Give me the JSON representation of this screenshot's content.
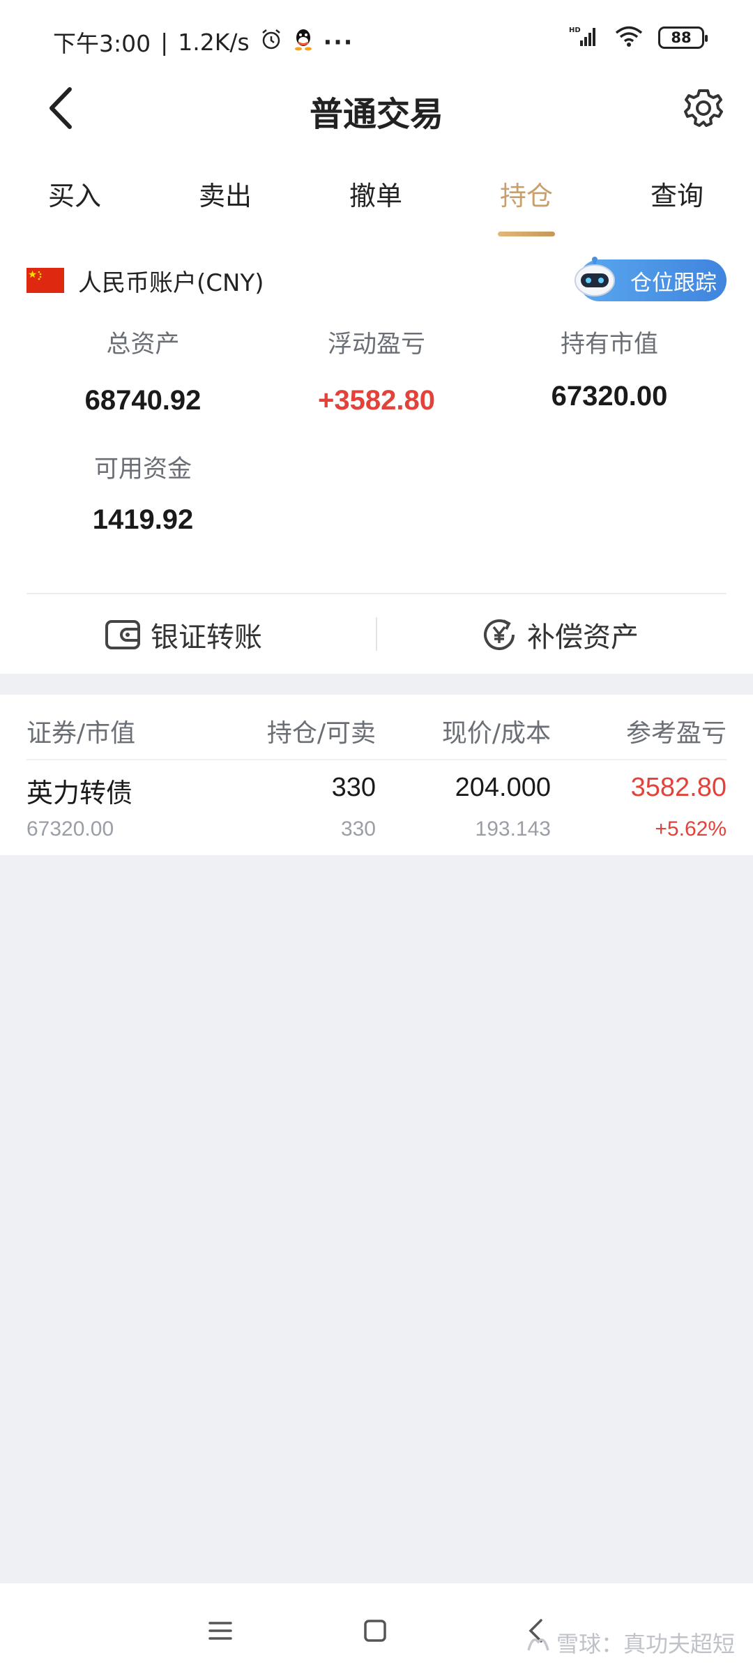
{
  "status_bar": {
    "time": "下午3:00",
    "speed": "1.2K/s",
    "battery": "88",
    "network": "HD"
  },
  "header": {
    "title": "普通交易"
  },
  "tabs": [
    {
      "label": "买入",
      "active": false
    },
    {
      "label": "卖出",
      "active": false
    },
    {
      "label": "撤单",
      "active": false
    },
    {
      "label": "持仓",
      "active": true
    },
    {
      "label": "查询",
      "active": false
    }
  ],
  "account": {
    "name": "人民币账户(CNY)",
    "track_label": "仓位跟踪"
  },
  "stats": {
    "total_assets_label": "总资产",
    "total_assets": "68740.92",
    "floating_pl_label": "浮动盈亏",
    "floating_pl": "+3582.80",
    "market_value_label": "持有市值",
    "market_value": "67320.00",
    "available_label": "可用资金",
    "available": "1419.92"
  },
  "actions": {
    "transfer": "银证转账",
    "compensate": "补偿资产"
  },
  "holdings": {
    "headers": [
      "证券/市值",
      "持仓/可卖",
      "现价/成本",
      "参考盈亏"
    ],
    "rows": [
      {
        "name": "英力转债",
        "market_value": "67320.00",
        "position": "330",
        "sellable": "330",
        "price": "204.000",
        "cost": "193.143",
        "pl": "3582.80",
        "pl_pct": "+5.62%"
      }
    ]
  },
  "watermark": "雪球：真功夫超短",
  "colors": {
    "accent_gold": "#c9a06c",
    "profit_red": "#e2423a",
    "track_blue": "#3f84de",
    "background": "#eef0f3"
  }
}
